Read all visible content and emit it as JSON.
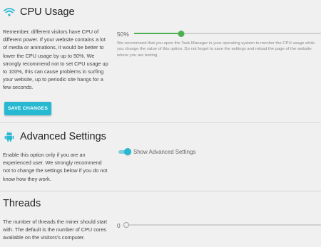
{
  "cpu": {
    "title": "CPU Usage",
    "icon": "wifi-icon",
    "description": "Remember, different visitors have CPU of different power. If your website contains a lot of media or animations, it would be better to lower the CPU usage by up to 50%. We strongly recommend not to set CPU usage up to 100%, this can cause problems in surfing your website, up to periodic site hangs for a few seconds.",
    "value_label": "50%",
    "value": 50,
    "hint": "We recommend that you open the Task Manager in your operating system to monitor the CPU usage while you change the value of this option. Do not forget to save the settings and reload the page of the website where you are testing.",
    "save_label": "SAVE CHANGES"
  },
  "advanced": {
    "title": "Advanced Settings",
    "icon": "android-icon",
    "description": "Enable this option only if you are an experienced user. We strongly recommend not to change the settings below if you do not know how they work.",
    "toggle_label": "Show Advanced Settings",
    "toggle_on": true
  },
  "threads": {
    "title": "Threads",
    "description": "The number of threads the miner should start with. The default is the number of CPU cores available on the visitors's computer.",
    "value_label": "0",
    "value": 0
  },
  "colors": {
    "accent": "#26b9d1",
    "slider": "#4caf50",
    "background": "#f0f0f0"
  }
}
